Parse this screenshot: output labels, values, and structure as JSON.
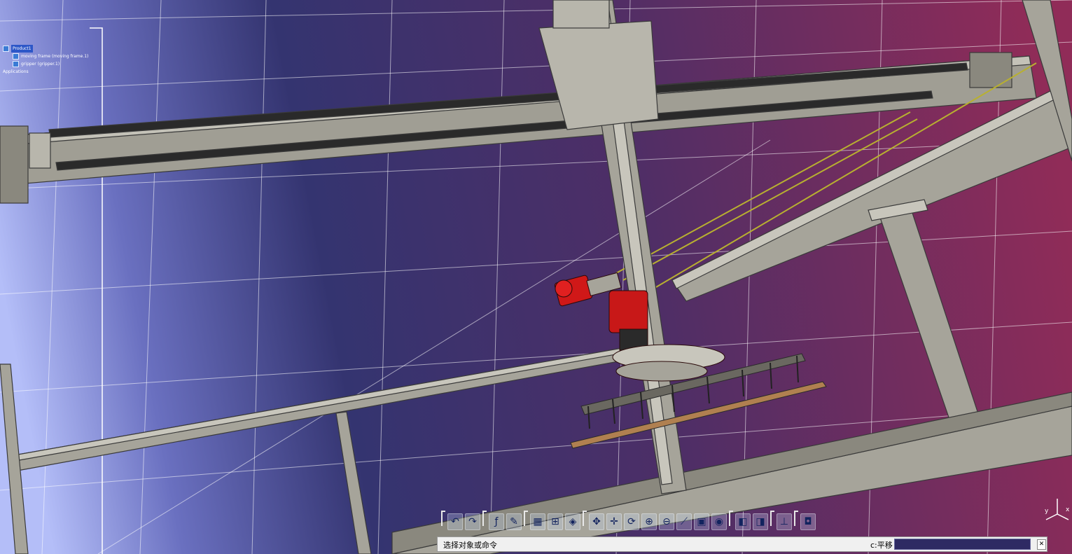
{
  "tree": {
    "root_label": "Product1",
    "items": [
      {
        "label": "moving frame (moving frame.1)"
      },
      {
        "label": "gripper (gripper.1)"
      }
    ],
    "applications_label": "Applications"
  },
  "toolbar": {
    "icons": [
      "undo-icon",
      "redo-icon",
      "formula-icon",
      "comment-icon",
      "table-icon",
      "tree-icon",
      "lock-icon",
      "fit-all-icon",
      "pan-icon",
      "rotate-icon",
      "zoom-in-icon",
      "zoom-out-icon",
      "normal-view-icon",
      "iso-view-icon",
      "shading-icon",
      "hide-show-icon",
      "swap-visible-icon",
      "measure-icon",
      "capture-icon"
    ]
  },
  "statusbar": {
    "prompt": "选择对象或命令",
    "command_label": "c:平移",
    "command_value": ""
  },
  "compass": {
    "axes": [
      "y",
      "x"
    ]
  },
  "colors": {
    "background_left": "#a8b4f2",
    "background_mid": "#3a3a7a",
    "background_right": "#8c2c5c",
    "frame_gray": "#9c9a8e",
    "motor_red": "#d01818",
    "board_tan": "#b08050"
  }
}
